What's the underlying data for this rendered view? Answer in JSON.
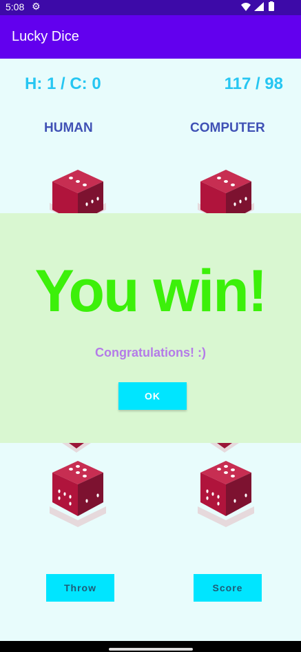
{
  "status": {
    "time": "5:08"
  },
  "app": {
    "title": "Lucky Dice"
  },
  "scores": {
    "hc": "H: 1 / C: 0",
    "totals": "117 / 98"
  },
  "labels": {
    "human": "HUMAN",
    "computer": "COMPUTER"
  },
  "dialog": {
    "title": "You win!",
    "message": "Congratulations! :)",
    "ok_label": "OK"
  },
  "buttons": {
    "throw": "Throw",
    "score": "Score"
  },
  "colors": {
    "app_bar": "#6200ee",
    "status_bar": "#3d0aa8",
    "accent": "#00e5ff",
    "win_text": "#3cf00a",
    "die_body": "#b0143c"
  }
}
